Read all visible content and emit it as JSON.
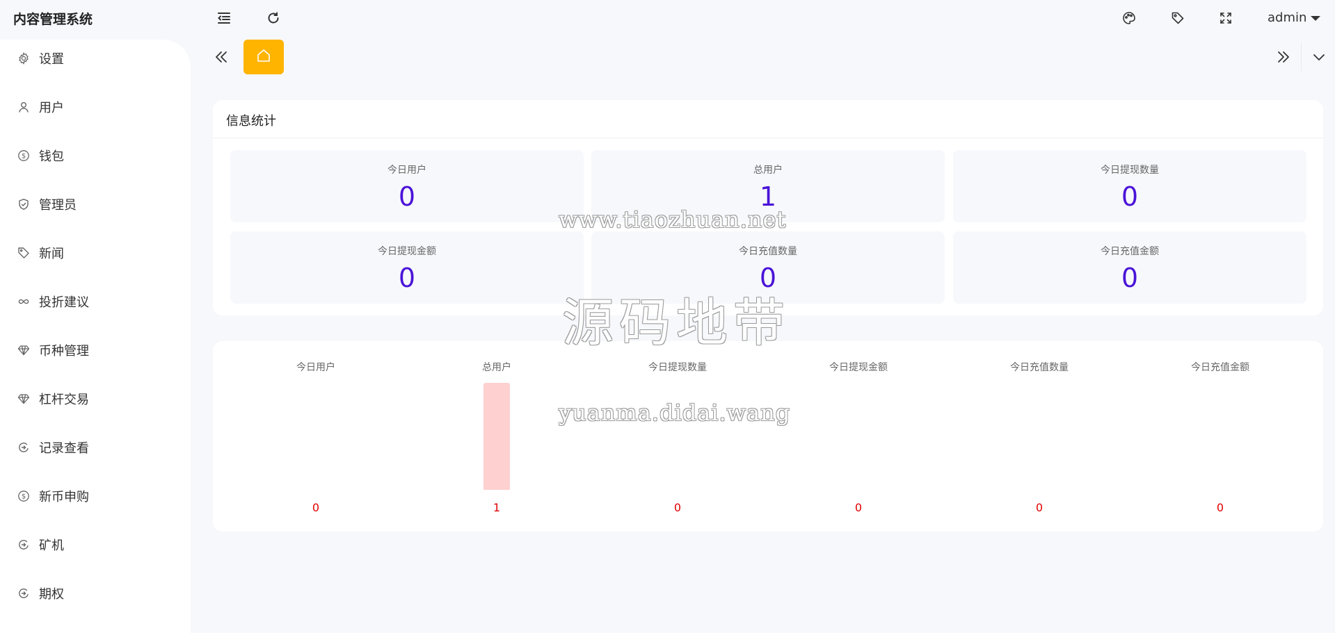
{
  "app": {
    "title": "内容管理系统"
  },
  "header": {
    "user": "admin"
  },
  "sidebar": {
    "items": [
      {
        "label": "设置",
        "icon": "gear-icon"
      },
      {
        "label": "用户",
        "icon": "user-icon"
      },
      {
        "label": "钱包",
        "icon": "dollar-circle-icon"
      },
      {
        "label": "管理员",
        "icon": "shield-check-icon"
      },
      {
        "label": "新闻",
        "icon": "tag-icon"
      },
      {
        "label": "投折建议",
        "icon": "infinity-icon"
      },
      {
        "label": "币种管理",
        "icon": "diamond-icon"
      },
      {
        "label": "杠杆交易",
        "icon": "diamond-icon"
      },
      {
        "label": "记录查看",
        "icon": "circle-arrow-icon"
      },
      {
        "label": "新币申购",
        "icon": "dollar-circle-icon"
      },
      {
        "label": "矿机",
        "icon": "circle-arrow-icon"
      },
      {
        "label": "期权",
        "icon": "circle-arrow-icon"
      }
    ]
  },
  "info_card": {
    "title": "信息统计",
    "stats": [
      {
        "label": "今日用户",
        "value": "0"
      },
      {
        "label": "总用户",
        "value": "1"
      },
      {
        "label": "今日提现数量",
        "value": "0"
      },
      {
        "label": "今日提现金额",
        "value": "0"
      },
      {
        "label": "今日充值数量",
        "value": "0"
      },
      {
        "label": "今日充值金额",
        "value": "0"
      }
    ]
  },
  "chart_data": {
    "type": "bar",
    "categories": [
      "今日用户",
      "总用户",
      "今日提现数量",
      "今日提现金额",
      "今日充值数量",
      "今日充值金额"
    ],
    "values": [
      0,
      1,
      0,
      0,
      0,
      0
    ],
    "ylim": [
      0,
      1
    ],
    "bar_color": "#ffd0d0",
    "value_label_color": "#e00000",
    "grid": false
  },
  "watermarks": {
    "line1": "www.tiaozhuan.net",
    "line2": "源码地带",
    "line3": "yuanma.didai.wang"
  },
  "colors": {
    "accent": "#ffb400",
    "stat_value": "#4a14d8",
    "background": "#f7f8fc"
  }
}
